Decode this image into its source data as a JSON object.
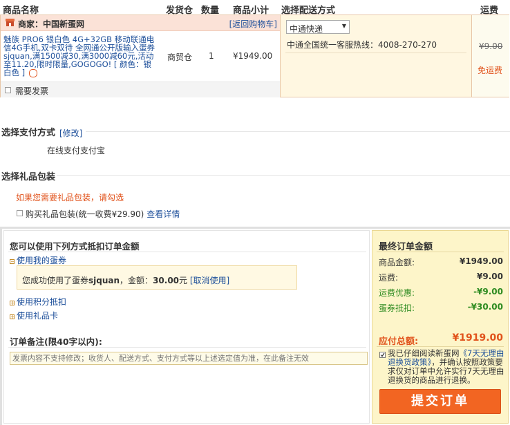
{
  "table_header": {
    "product_name": "商品名称",
    "warehouse": "发货仓",
    "quantity": "数量",
    "subtotal": "商品小计",
    "shipping_method": "选择配送方式",
    "shipping_fee": "运费"
  },
  "merchant": {
    "label": "商家：中国新蛋网",
    "back_to_cart": "[返回购物车]"
  },
  "product": {
    "description": "魅族 PRO6 银白色 4G+32GB 移动联通电信4G手机,双卡双待 全网通公开版输入蛋券sjquan,满1500减30,满3000减60元,活动至11.20,限时限量,GOGOGO! [ 颜色：银白色 ]",
    "warehouse": "商贸仓",
    "quantity": "1",
    "subtotal": "¥1949.00"
  },
  "shipping": {
    "selected": "中通快递",
    "hotline": "中通全国统一客服热线：4008-270-270",
    "original_fee": "¥9.00",
    "free_label": "免运费"
  },
  "invoice_label": "需要发票",
  "payment": {
    "title": "选择支付方式",
    "modify": "[修改]",
    "method": "在线支付支付宝"
  },
  "gift": {
    "title": "选择礼品包装",
    "hint": "如果您需要礼品包装，请勾选",
    "option": "购买礼品包装(统一收费¥29.90)",
    "details_link": "查看详情"
  },
  "deduction": {
    "title": "您可以使用下列方式抵扣订单金额",
    "coupon_toggle": "使用我的蛋券",
    "coupon_msg_prefix": "您成功使用了蛋券",
    "coupon_code": "sjquan",
    "coupon_msg_mid": "，金额：",
    "coupon_amount": "30.00",
    "coupon_msg_unit": "元",
    "coupon_cancel": "[取消使用]",
    "points_toggle": "使用积分抵扣",
    "giftcard_toggle": "使用礼品卡"
  },
  "remark": {
    "title": "订单备注(限40字以内):",
    "placeholder": "发票内容不支持修改；收货人、配送方式、支付方式等以上述选定值为准，在此备注无效"
  },
  "summary": {
    "title": "最终订单金额",
    "rows": [
      {
        "label": "商品金额:",
        "value": "¥1949.00"
      },
      {
        "label": "运费:",
        "value": "¥9.00"
      },
      {
        "label": "运费优惠:",
        "value": "-¥9.00"
      },
      {
        "label": "蛋券抵扣:",
        "value": "-¥30.00"
      }
    ],
    "total_label": "应付总额:",
    "total_value": "¥1919.00",
    "agree_prefix": "我已仔细阅读新蛋网",
    "agree_link": "《7天无理由退换货政策》",
    "agree_suffix": "，并确认按照政策要求仅对订单中允许实行7天无理由退换货的商品进行退换。",
    "submit": "提交订单"
  },
  "colors": {
    "orange": "#e1531c",
    "blue": "#1d4f9a",
    "highlight_bg": "#fff7e1",
    "summary_bg": "#fdf5c9",
    "button": "#f26522"
  }
}
